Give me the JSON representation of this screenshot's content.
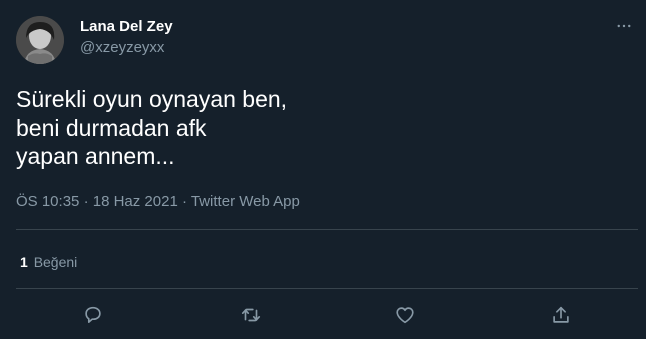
{
  "author": {
    "display_name": "Lana Del Zey",
    "handle": "@xzeyzeyxx",
    "avatar_icon": "profile-photo"
  },
  "tweet": {
    "text": "Sürekli oyun oynayan ben,\nbeni durmadan afk\nyapan annem..."
  },
  "meta": {
    "time": "ÖS 10:35",
    "separator1": "·",
    "date": "18 Haz 2021",
    "separator2": "·",
    "source": "Twitter Web App"
  },
  "stats": {
    "likes_count": "1",
    "likes_label": "Beğeni"
  },
  "icons": {
    "more": "more-dots-icon",
    "reply": "reply-icon",
    "retweet": "retweet-icon",
    "like": "heart-icon",
    "share": "share-icon"
  },
  "colors": {
    "background": "#15202b",
    "secondary_text": "#8899a6",
    "divider": "#38444d",
    "primary_text": "#ffffff"
  }
}
